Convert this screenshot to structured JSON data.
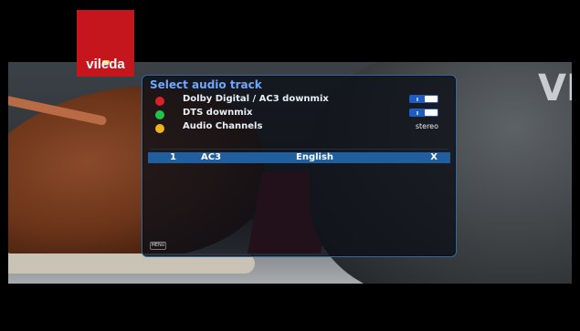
{
  "branding": {
    "logo_text": "vileda",
    "background_text": "VI"
  },
  "dialog": {
    "title": "Select audio track",
    "options": [
      {
        "label": "Dolby Digital / AC3 downmix",
        "color": "#d9212b",
        "right_type": "toggle"
      },
      {
        "label": "DTS downmix",
        "color": "#23c04a",
        "right_type": "toggle"
      },
      {
        "label": "Audio Channels",
        "color": "#f0b31f",
        "right_type": "text",
        "value": "stereo"
      }
    ],
    "selected_row": {
      "number": "1",
      "codec": "AC3",
      "language": "English",
      "marker": "X"
    },
    "menu_label": "MENU"
  }
}
